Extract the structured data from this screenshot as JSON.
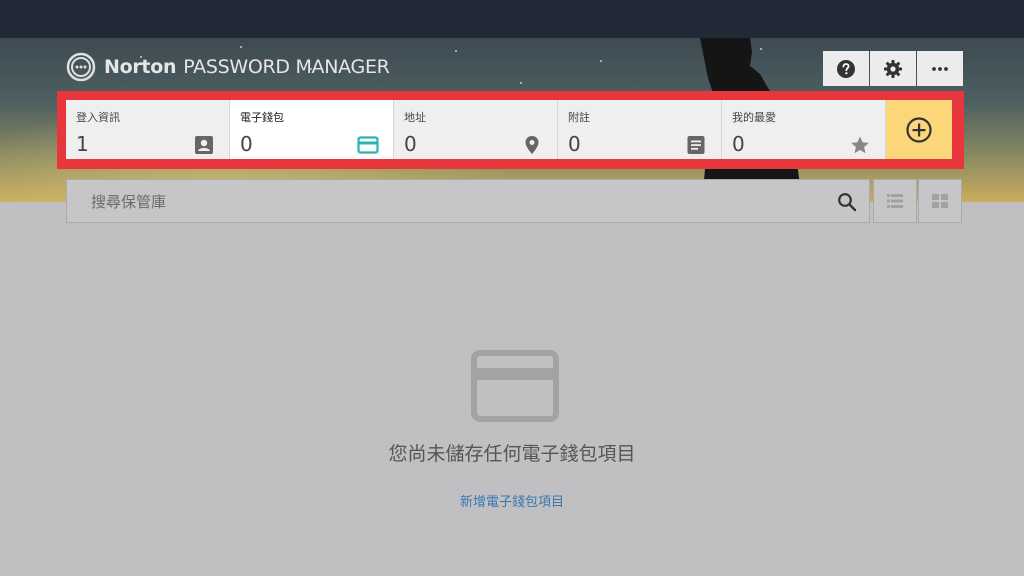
{
  "header": {
    "brand": "Norton",
    "product": "PASSWORD MANAGER",
    "actions": [
      {
        "name": "help",
        "icon": "help-icon"
      },
      {
        "name": "settings",
        "icon": "gear-icon"
      },
      {
        "name": "more",
        "icon": "more-horizontal-icon"
      }
    ]
  },
  "tabs": [
    {
      "label": "登入資訊",
      "count": "1",
      "icon": "contact-card-icon",
      "active": false
    },
    {
      "label": "電子錢包",
      "count": "0",
      "icon": "credit-card-icon",
      "active": true
    },
    {
      "label": "地址",
      "count": "0",
      "icon": "map-pin-icon",
      "active": false
    },
    {
      "label": "附註",
      "count": "0",
      "icon": "note-icon",
      "active": false
    },
    {
      "label": "我的最愛",
      "count": "0",
      "icon": "star-icon",
      "active": false
    }
  ],
  "add_button": {
    "icon": "plus-circle-icon"
  },
  "search": {
    "placeholder": "搜尋保管庫",
    "icon": "search-icon"
  },
  "view_toggle": [
    {
      "name": "list-view",
      "icon": "list-icon"
    },
    {
      "name": "grid-view",
      "icon": "grid-icon"
    }
  ],
  "empty_state": {
    "icon": "credit-card-icon",
    "message": "您尚未儲存任何電子錢包項目",
    "link": "新增電子錢包項目"
  },
  "colors": {
    "top_bar": "#212836",
    "highlight_frame": "#e8373c",
    "add_button": "#fbd77a",
    "wallet_accent": "#27b5b4",
    "link": "#3a78b0",
    "body_background": "#c0c0c2"
  }
}
